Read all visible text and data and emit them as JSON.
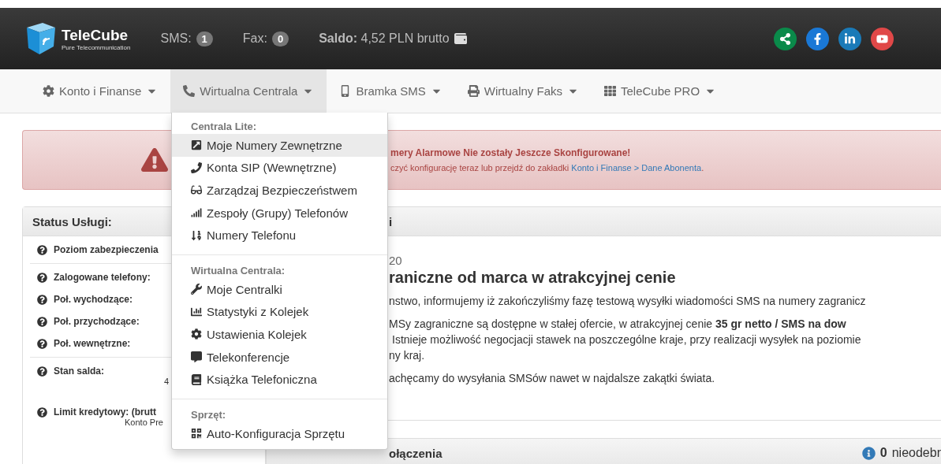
{
  "header": {
    "brand": {
      "name": "TeleCube",
      "tagline": "Pure Telecommunication"
    },
    "counters": [
      {
        "label": "SMS:",
        "count": "1"
      },
      {
        "label": "Fax:",
        "count": "0"
      }
    ],
    "balance": {
      "label": "Saldo:",
      "value": "4,52 PLN brutto"
    },
    "social": [
      {
        "kind": "share"
      },
      {
        "kind": "facebook"
      },
      {
        "kind": "linkedin"
      },
      {
        "kind": "youtube"
      }
    ]
  },
  "nav": [
    {
      "label": "Konto i Finanse",
      "kind": "gear",
      "selected": false
    },
    {
      "label": "Wirtualna Centrala",
      "kind": "phone",
      "selected": true
    },
    {
      "label": "Bramka SMS",
      "kind": "mobile",
      "selected": false
    },
    {
      "label": "Wirtualny Faks",
      "kind": "print",
      "selected": false
    },
    {
      "label": "TeleCube PRO",
      "kind": "grid",
      "selected": false
    }
  ],
  "dropdown": [
    {
      "heading": "Centrala Lite:",
      "items": [
        {
          "label": "Moje Numery Zewnętrzne",
          "kind": "external",
          "selected": true
        },
        {
          "label": "Konta SIP (Wewnętrzne)",
          "kind": "handset",
          "selected": false
        },
        {
          "label": "Zarządzaj Bezpieczeństwem",
          "kind": "glasses",
          "selected": false
        },
        {
          "label": "Zespoły (Grupy) Telefonów",
          "kind": "bars",
          "selected": false
        },
        {
          "label": "Numery Telefonu",
          "kind": "sort",
          "selected": false
        }
      ]
    },
    {
      "heading": "Wirtualna Centrala:",
      "items": [
        {
          "label": "Moje Centralki",
          "kind": "wrench",
          "selected": false
        },
        {
          "label": "Statystyki z Kolejek",
          "kind": "chart",
          "selected": false
        },
        {
          "label": "Ustawienia Kolejek",
          "kind": "gear",
          "selected": false
        },
        {
          "label": "Telekonferencje",
          "kind": "comment",
          "selected": false
        },
        {
          "label": "Książka Telefoniczna",
          "kind": "book",
          "selected": false
        }
      ]
    },
    {
      "heading": "Sprzęt:",
      "items": [
        {
          "label": "Auto-Konfiguracja Sprzętu",
          "kind": "qrcode",
          "selected": false
        }
      ]
    }
  ],
  "alert": {
    "title": "mery Alarmowe Nie zostały Jeszcze Skonfigurowane!",
    "text": "czyć konfigurację teraz lub przejdź do zakładki",
    "link": "Konto i Finanse > Dane Abonenta",
    "after": "."
  },
  "status_panel": {
    "title": "Status Usługi:",
    "groups": [
      [
        {
          "label": "Poziom zabezpieczenia"
        }
      ],
      [
        {
          "label": "Zalogowane telefony:"
        },
        {
          "label": "Poł. wychodzące:"
        },
        {
          "label": "Poł. przychodzące:"
        },
        {
          "label": "Poł. wewnętrzne:"
        }
      ],
      [
        {
          "label": "Stan salda:",
          "value": "4"
        },
        {
          "label": "Limit kredytowy: (brutt",
          "value": "Konto Pre"
        }
      ]
    ]
  },
  "news_panel": {
    "title": "i",
    "date": "20",
    "headline": "raniczne od marca w atrakcyjnej cenie",
    "paragraphs": [
      [
        "nstwo, informujemy iż zakończyliśmy fazę testową wysyłki wiadomości SMS na numery zagranicz"
      ],
      [
        "MSy zagraniczne są dostępne w stałej ofercie, w atrakcyjnej cenie **35 gr netto / SMS na dow**",
        "Istnieje możliwość negocjacji stawek na poszczególne kraje, przy realizacji wysyłek na poziomie",
        "ny kraj."
      ],
      [
        "achęcamy do wysyłania SMSów nawet w najdalsze zakątki świata."
      ]
    ]
  },
  "calls_panel": {
    "title": "ołączenia",
    "count": "0",
    "text": "nieodebr"
  }
}
